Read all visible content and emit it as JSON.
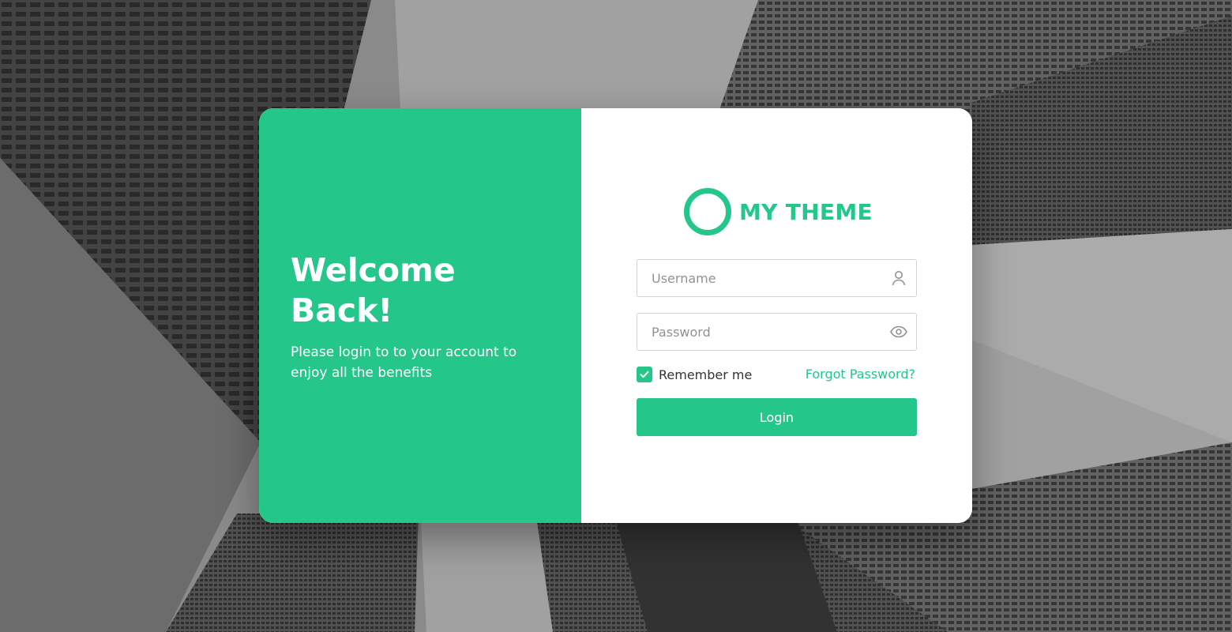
{
  "welcome": {
    "title": "Welcome Back!",
    "subtitle": "Please login to to your account to enjoy all the benefits"
  },
  "brand": {
    "name": "MY THEME",
    "accent_color": "#24c68a"
  },
  "form": {
    "username_placeholder": "Username",
    "username_value": "",
    "username_icon": "user-icon",
    "password_placeholder": "Password",
    "password_value": "",
    "password_icon": "eye-icon",
    "remember_label": "Remember me",
    "remember_checked": true,
    "forgot_label": "Forgot Password?",
    "login_label": "Login"
  }
}
